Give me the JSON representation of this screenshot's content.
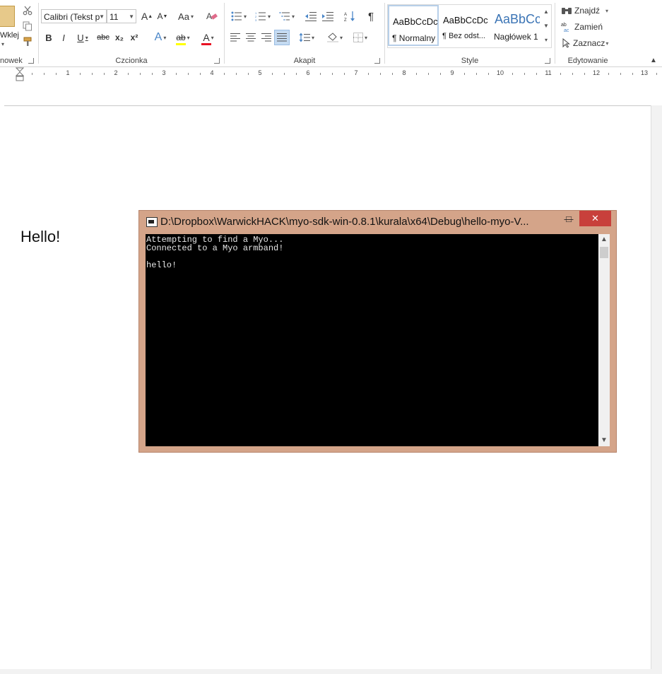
{
  "ribbon": {
    "groups": {
      "clipboard": {
        "label": "nowek",
        "paste_label": "Wklej"
      },
      "font": {
        "label": "Czcionka",
        "font_name": "Calibri (Tekst p",
        "font_size": "11",
        "grow_label": "A",
        "shrink_label": "A",
        "case_label": "Aa",
        "bold": "B",
        "italic": "I",
        "underline": "U",
        "strike": "abc",
        "subscript": "x₂",
        "superscript": "x²",
        "effects": "A",
        "highlight": "ab",
        "font_color": "A"
      },
      "paragraph": {
        "label": "Akapit",
        "pilcrow": "¶"
      },
      "styles": {
        "label": "Style",
        "tiles": [
          {
            "sample": "AaBbCcDc",
            "name": "¶ Normalny"
          },
          {
            "sample": "AaBbCcDc",
            "name": "¶ Bez odst..."
          },
          {
            "sample": "AaBbCc",
            "name": "Nagłówek 1"
          }
        ]
      },
      "editing": {
        "label": "Edytowanie",
        "find": "Znajdź",
        "replace": "Zamień",
        "select": "Zaznacz"
      }
    },
    "collapse_icon": "chevron-up-icon"
  },
  "ruler": {
    "labels": [
      "1",
      "2",
      "3",
      "4",
      "5",
      "6",
      "7",
      "8",
      "9",
      "10",
      "11",
      "12",
      "13"
    ]
  },
  "document": {
    "text": "Hello!"
  },
  "console": {
    "title": "D:\\Dropbox\\WarwickHACK\\myo-sdk-win-0.8.1\\kurala\\x64\\Debug\\hello-myo-V...",
    "output": "Attempting to find a Myo...\nConnected to a Myo armband!\n\nhello!",
    "buttons": {
      "minimize": "—",
      "maximize": "□",
      "close": "✕"
    }
  },
  "colors": {
    "console_frame": "#d4a489",
    "close_button": "#c8403b",
    "highlight_yellow": "#ffff00",
    "font_color_red": "#e81123"
  }
}
